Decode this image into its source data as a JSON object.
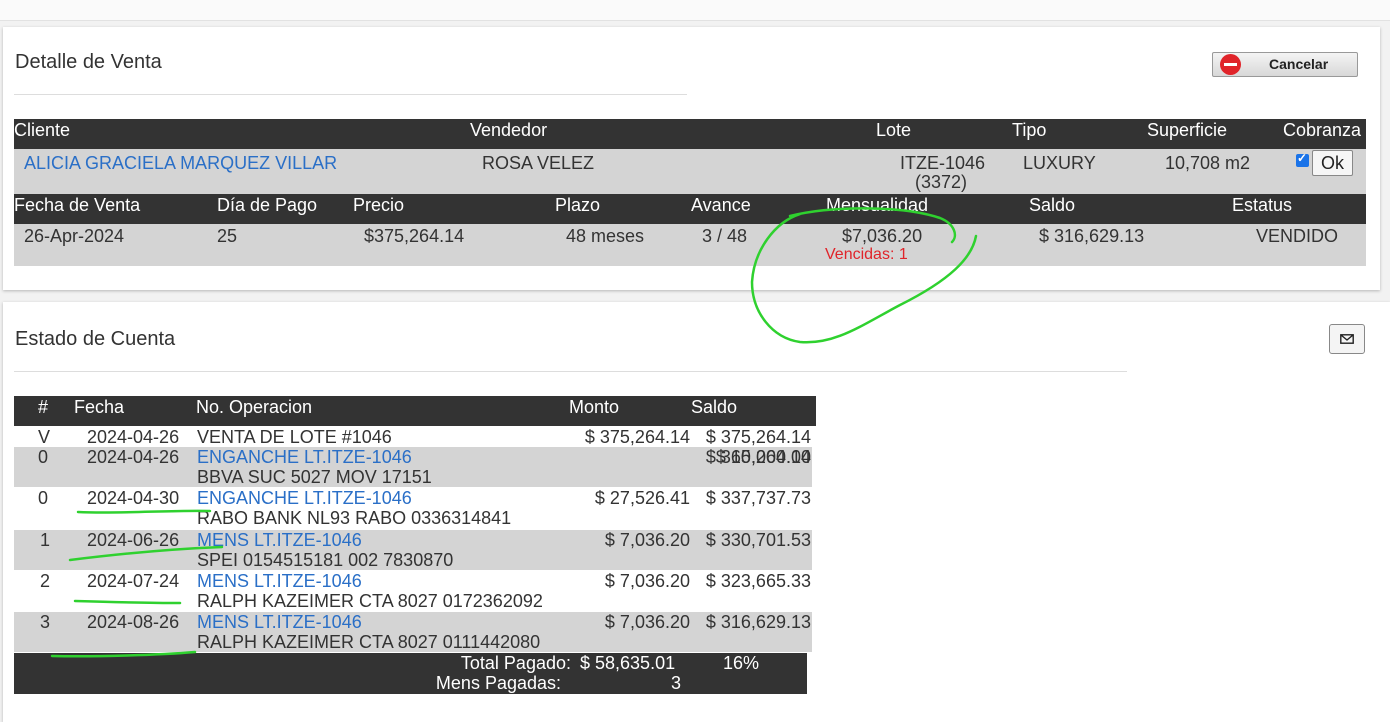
{
  "detalle": {
    "title": "Detalle de Venta",
    "cancel_label": "Cancelar",
    "headers1": {
      "cliente": "Cliente",
      "vendedor": "Vendedor",
      "lote": "Lote",
      "tipo": "Tipo",
      "superficie": "Superficie",
      "cobranza": "Cobranza"
    },
    "row1": {
      "cliente": "ALICIA GRACIELA MARQUEZ VILLAR",
      "vendedor": "ROSA VELEZ",
      "lote": "ITZE-1046",
      "lote_sub": "(3372)",
      "tipo": "LUXURY",
      "superficie": "10,708 m2",
      "cobranza_checked": true,
      "ok_label": "Ok"
    },
    "headers2": {
      "fecha": "Fecha de Venta",
      "dia": "Día de Pago",
      "precio": "Precio",
      "plazo": "Plazo",
      "avance": "Avance",
      "mensualidad": "Mensualidad",
      "saldo": "Saldo",
      "estatus": "Estatus"
    },
    "row2": {
      "fecha": "26-Apr-2024",
      "dia": "25",
      "precio": "$375,264.14",
      "plazo": "48 meses",
      "avance": "3 / 48",
      "mensualidad": "$7,036.20",
      "vencidas": "Vencidas: 1",
      "saldo": "$ 316,629.13",
      "estatus": "VENDIDO"
    }
  },
  "estado": {
    "title": "Estado de Cuenta",
    "email_icon": "envelope-icon",
    "headers": {
      "num": "#",
      "fecha": "Fecha",
      "operacion": "No. Operacion",
      "monto": "Monto",
      "saldo": "Saldo"
    },
    "rows": [
      {
        "num": "V",
        "fecha": "2024-04-26",
        "op": "VENTA DE LOTE #1046",
        "op2": "",
        "monto": "$ 375,264.14",
        "saldo": "$ 375,264.14"
      },
      {
        "num": "0",
        "fecha": "2024-04-26",
        "op": "ENGANCHE LT.ITZE-1046",
        "op2": "BBVA SUC 5027 MOV 17151",
        "monto": "$ 10,000.00",
        "saldo": "$ 365,264.14"
      },
      {
        "num": "0",
        "fecha": "2024-04-30",
        "op": "ENGANCHE LT.ITZE-1046",
        "op2": "RABO BANK NL93 RABO 0336314841",
        "monto": "$ 27,526.41",
        "saldo": "$ 337,737.73"
      },
      {
        "num": "1",
        "fecha": "2024-06-26",
        "op": "MENS LT.ITZE-1046",
        "op2": "SPEI 0154515181 002 7830870",
        "monto": "$ 7,036.20",
        "saldo": "$ 330,701.53"
      },
      {
        "num": "2",
        "fecha": "2024-07-24",
        "op": "MENS LT.ITZE-1046",
        "op2": "RALPH KAZEIMER CTA 8027 0172362092",
        "monto": "$ 7,036.20",
        "saldo": "$ 323,665.33"
      },
      {
        "num": "3",
        "fecha": "2024-08-26",
        "op": "MENS LT.ITZE-1046",
        "op2": "RALPH KAZEIMER CTA 8027 0111442080",
        "monto": "$ 7,036.20",
        "saldo": "$ 316,629.13"
      }
    ],
    "totals": {
      "total_label": "Total Pagado:",
      "total_value": "$ 58,635.01",
      "percent": "16%",
      "mens_label": "Mens Pagadas:",
      "mens_value": "3"
    }
  },
  "colors": {
    "header_bg": "#333333",
    "row_grey": "#d4d4d4",
    "link": "#2a6fc7",
    "alert": "#e0242a",
    "annotation": "#2fd12f"
  }
}
